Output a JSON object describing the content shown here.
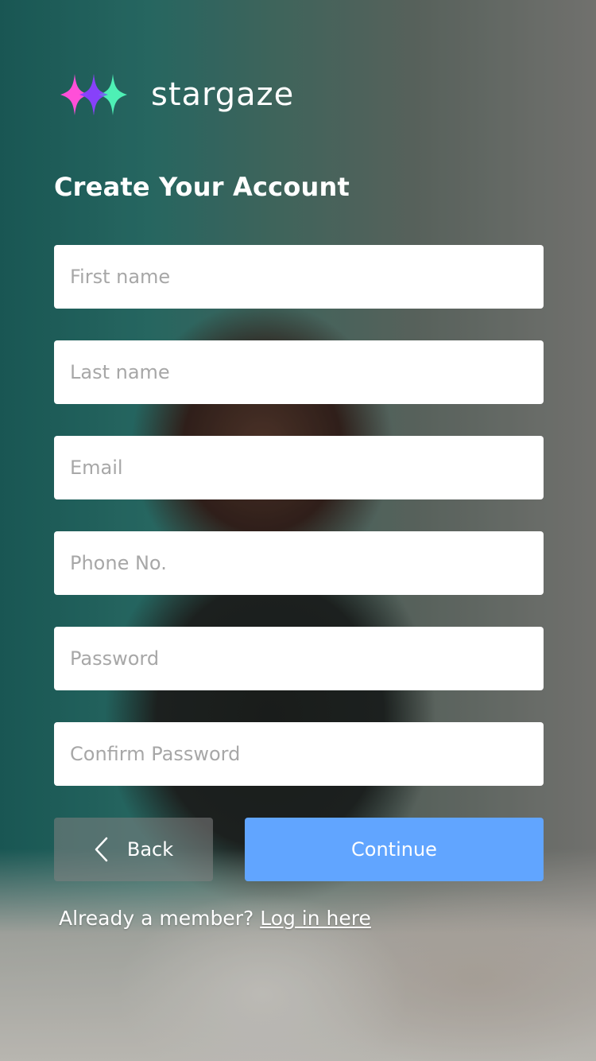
{
  "brand": {
    "name": "stargaze",
    "logo_icon": "stargaze-logo-icon",
    "colors": {
      "magenta": "#ff4fd8",
      "mint": "#4ef0b5",
      "purple": "#b34dff"
    }
  },
  "page_title": "Create Your Account",
  "form": {
    "first_name": {
      "placeholder": "First name",
      "value": ""
    },
    "last_name": {
      "placeholder": "Last name",
      "value": ""
    },
    "email": {
      "placeholder": "Email",
      "value": ""
    },
    "phone": {
      "placeholder": "Phone No.",
      "value": ""
    },
    "password": {
      "placeholder": "Password",
      "value": ""
    },
    "confirm_password": {
      "placeholder": "Confirm Password",
      "value": ""
    }
  },
  "buttons": {
    "back_label": "Back",
    "back_icon": "chevron-left-icon",
    "continue_label": "Continue",
    "continue_color": "#61a5ff"
  },
  "footer": {
    "prompt": "Already a member?",
    "login_link": "Log in here"
  }
}
